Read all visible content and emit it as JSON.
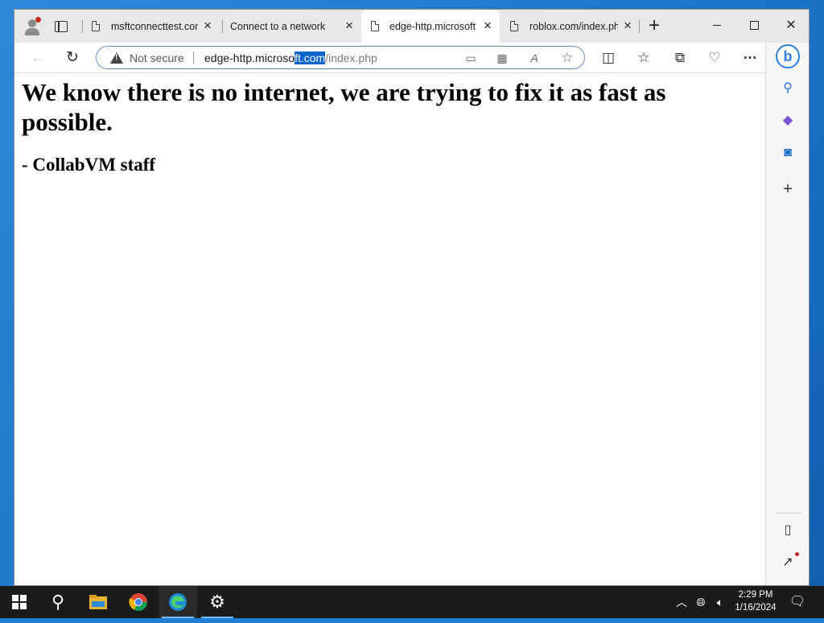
{
  "browser": {
    "tabs": [
      {
        "title": "msftconnecttest.com",
        "active": false
      },
      {
        "title": "Connect to a network",
        "active": false
      },
      {
        "title": "edge-http.microsoft.com/index.php",
        "active": true
      },
      {
        "title": "roblox.com/index.php",
        "active": false
      }
    ],
    "new_tab_glyph": "+",
    "close_glyph": "×",
    "address": {
      "security_label": "Not secure",
      "url_host_before_selection": "edge-http.microso",
      "url_selected": "ft.com",
      "url_path": "/index.php"
    }
  },
  "page": {
    "heading": "We know there is no internet, we are trying to fix it as fast as possible.",
    "signature": "- CollabVM staff"
  },
  "sidebar": {
    "bing_glyph": "b",
    "add_glyph": "+"
  },
  "taskbar": {
    "clock_time": "2:29 PM",
    "clock_date": "1/16/2024"
  },
  "colors": {
    "accent": "#0a63c9",
    "desktop": "#1a74c4",
    "taskbar": "#1b1b1b",
    "warning_dot": "#c42b1c"
  }
}
